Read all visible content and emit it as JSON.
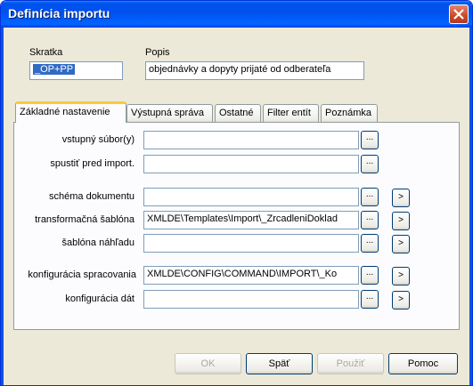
{
  "window": {
    "title": "Definícia importu"
  },
  "header": {
    "skratka_label": "Skratka",
    "skratka_value": "_OP+PP",
    "popis_label": "Popis",
    "popis_value": "objednávky a dopyty prijaté od odberateľa"
  },
  "tabs": [
    {
      "label": "Základné nastavenie",
      "active": true
    },
    {
      "label": "Výstupná správa"
    },
    {
      "label": "Ostatné"
    },
    {
      "label": "Filter entít"
    },
    {
      "label": "Poznámka"
    }
  ],
  "form": {
    "vstupny_subor": {
      "label": "vstupný súbor(y)",
      "value": ""
    },
    "spustit_pred_import": {
      "label": "spustiť pred import.",
      "value": ""
    },
    "schema_dokumentu": {
      "label": "schéma dokumentu",
      "value": ""
    },
    "transformacna_sablona": {
      "label": "transformačná šablóna",
      "value": "XMLDE\\Templates\\Import\\_ZrcadleniDoklad"
    },
    "sablona_nahladu": {
      "label": "šablóna náhľadu",
      "value": ""
    },
    "konfiguracia_spracovania": {
      "label": "konfigurácia spracovania",
      "value": "XMLDE\\CONFIG\\COMMAND\\IMPORT\\_Ko"
    },
    "konfiguracia_dat": {
      "label": "konfigurácia dát",
      "value": ""
    },
    "browse_label": "...",
    "arrow_label": ">"
  },
  "buttons": {
    "ok": "OK",
    "spat": "Späť",
    "pouzit": "Použiť",
    "pomoc": "Pomoc"
  },
  "colors": {
    "titlebar": "#0055e5",
    "dialog_bg": "#ece9d8",
    "selection": "#316ac5",
    "active_tab_accent": "#ffc83c"
  }
}
